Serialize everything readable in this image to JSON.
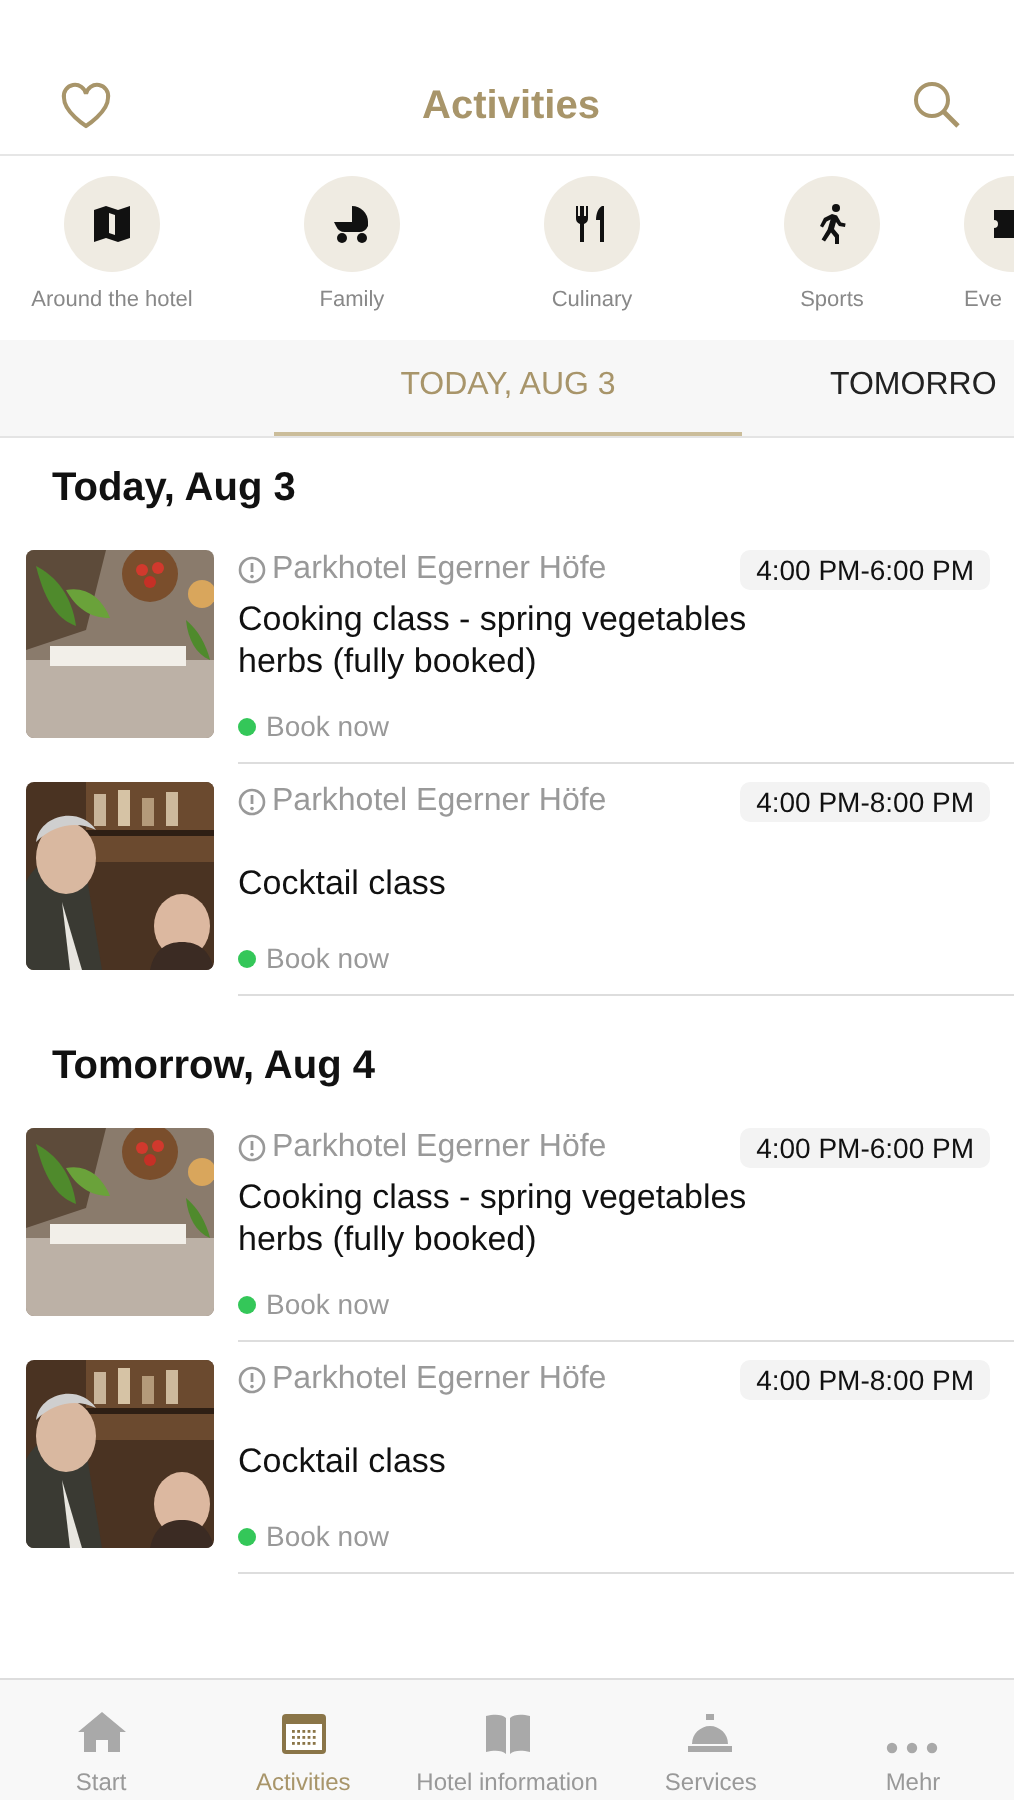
{
  "header": {
    "title": "Activities"
  },
  "categories": [
    {
      "label": "Around the hotel"
    },
    {
      "label": "Family"
    },
    {
      "label": "Culinary"
    },
    {
      "label": "Sports"
    },
    {
      "label": "Eve"
    }
  ],
  "date_tabs": [
    {
      "label": "TODAY, AUG 3",
      "selected": true
    },
    {
      "label": "TOMORRO",
      "selected": false
    }
  ],
  "sections": [
    {
      "heading": "Today, Aug 3",
      "events": [
        {
          "venue": "Parkhotel Egerner Höfe",
          "time": "4:00 PM-6:00 PM",
          "title": "Cooking class - spring vegetables herbs (fully booked)",
          "action": "Book now",
          "kind": "picture"
        },
        {
          "venue": "Parkhotel Egerner Höfe",
          "time": "4:00 PM-8:00 PM",
          "title": "Cocktail class",
          "action": "Book now",
          "kind": "picture"
        }
      ]
    },
    {
      "heading": "Tomorrow, Aug 4",
      "events": [
        {
          "venue": "Parkhotel Egerner Höfe",
          "time": "4:00 PM-6:00 PM",
          "title": "Cooking class - spring vegetables herbs (fully booked)",
          "action": "Book now",
          "kind": "picture"
        },
        {
          "venue": "Parkhotel Egerner Höfe",
          "time": "4:00 PM-8:00 PM",
          "title": "Cocktail class",
          "action": "Book now",
          "kind": "picture"
        }
      ]
    }
  ],
  "tab_bar": [
    {
      "label": "Start",
      "selected": false
    },
    {
      "label": "Activities",
      "selected": true
    },
    {
      "label": "Hotel information",
      "selected": false
    },
    {
      "label": "Services",
      "selected": false
    },
    {
      "label": "Mehr",
      "selected": false
    }
  ]
}
